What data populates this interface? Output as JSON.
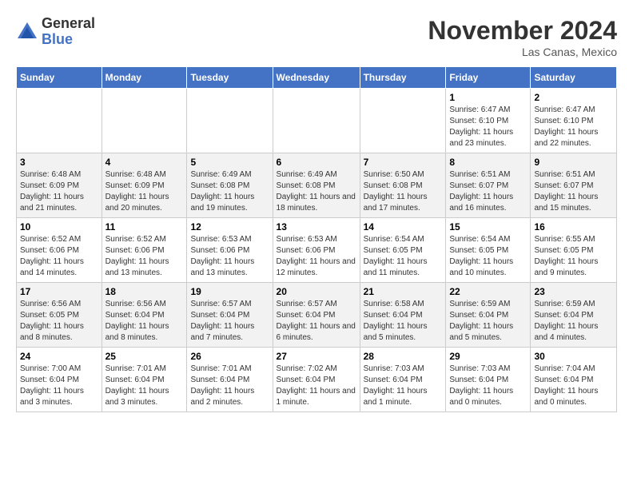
{
  "logo": {
    "general": "General",
    "blue": "Blue"
  },
  "header": {
    "month": "November 2024",
    "location": "Las Canas, Mexico"
  },
  "weekdays": [
    "Sunday",
    "Monday",
    "Tuesday",
    "Wednesday",
    "Thursday",
    "Friday",
    "Saturday"
  ],
  "weeks": [
    [
      {
        "day": "",
        "info": ""
      },
      {
        "day": "",
        "info": ""
      },
      {
        "day": "",
        "info": ""
      },
      {
        "day": "",
        "info": ""
      },
      {
        "day": "",
        "info": ""
      },
      {
        "day": "1",
        "info": "Sunrise: 6:47 AM\nSunset: 6:10 PM\nDaylight: 11 hours and 23 minutes."
      },
      {
        "day": "2",
        "info": "Sunrise: 6:47 AM\nSunset: 6:10 PM\nDaylight: 11 hours and 22 minutes."
      }
    ],
    [
      {
        "day": "3",
        "info": "Sunrise: 6:48 AM\nSunset: 6:09 PM\nDaylight: 11 hours and 21 minutes."
      },
      {
        "day": "4",
        "info": "Sunrise: 6:48 AM\nSunset: 6:09 PM\nDaylight: 11 hours and 20 minutes."
      },
      {
        "day": "5",
        "info": "Sunrise: 6:49 AM\nSunset: 6:08 PM\nDaylight: 11 hours and 19 minutes."
      },
      {
        "day": "6",
        "info": "Sunrise: 6:49 AM\nSunset: 6:08 PM\nDaylight: 11 hours and 18 minutes."
      },
      {
        "day": "7",
        "info": "Sunrise: 6:50 AM\nSunset: 6:08 PM\nDaylight: 11 hours and 17 minutes."
      },
      {
        "day": "8",
        "info": "Sunrise: 6:51 AM\nSunset: 6:07 PM\nDaylight: 11 hours and 16 minutes."
      },
      {
        "day": "9",
        "info": "Sunrise: 6:51 AM\nSunset: 6:07 PM\nDaylight: 11 hours and 15 minutes."
      }
    ],
    [
      {
        "day": "10",
        "info": "Sunrise: 6:52 AM\nSunset: 6:06 PM\nDaylight: 11 hours and 14 minutes."
      },
      {
        "day": "11",
        "info": "Sunrise: 6:52 AM\nSunset: 6:06 PM\nDaylight: 11 hours and 13 minutes."
      },
      {
        "day": "12",
        "info": "Sunrise: 6:53 AM\nSunset: 6:06 PM\nDaylight: 11 hours and 13 minutes."
      },
      {
        "day": "13",
        "info": "Sunrise: 6:53 AM\nSunset: 6:06 PM\nDaylight: 11 hours and 12 minutes."
      },
      {
        "day": "14",
        "info": "Sunrise: 6:54 AM\nSunset: 6:05 PM\nDaylight: 11 hours and 11 minutes."
      },
      {
        "day": "15",
        "info": "Sunrise: 6:54 AM\nSunset: 6:05 PM\nDaylight: 11 hours and 10 minutes."
      },
      {
        "day": "16",
        "info": "Sunrise: 6:55 AM\nSunset: 6:05 PM\nDaylight: 11 hours and 9 minutes."
      }
    ],
    [
      {
        "day": "17",
        "info": "Sunrise: 6:56 AM\nSunset: 6:05 PM\nDaylight: 11 hours and 8 minutes."
      },
      {
        "day": "18",
        "info": "Sunrise: 6:56 AM\nSunset: 6:04 PM\nDaylight: 11 hours and 8 minutes."
      },
      {
        "day": "19",
        "info": "Sunrise: 6:57 AM\nSunset: 6:04 PM\nDaylight: 11 hours and 7 minutes."
      },
      {
        "day": "20",
        "info": "Sunrise: 6:57 AM\nSunset: 6:04 PM\nDaylight: 11 hours and 6 minutes."
      },
      {
        "day": "21",
        "info": "Sunrise: 6:58 AM\nSunset: 6:04 PM\nDaylight: 11 hours and 5 minutes."
      },
      {
        "day": "22",
        "info": "Sunrise: 6:59 AM\nSunset: 6:04 PM\nDaylight: 11 hours and 5 minutes."
      },
      {
        "day": "23",
        "info": "Sunrise: 6:59 AM\nSunset: 6:04 PM\nDaylight: 11 hours and 4 minutes."
      }
    ],
    [
      {
        "day": "24",
        "info": "Sunrise: 7:00 AM\nSunset: 6:04 PM\nDaylight: 11 hours and 3 minutes."
      },
      {
        "day": "25",
        "info": "Sunrise: 7:01 AM\nSunset: 6:04 PM\nDaylight: 11 hours and 3 minutes."
      },
      {
        "day": "26",
        "info": "Sunrise: 7:01 AM\nSunset: 6:04 PM\nDaylight: 11 hours and 2 minutes."
      },
      {
        "day": "27",
        "info": "Sunrise: 7:02 AM\nSunset: 6:04 PM\nDaylight: 11 hours and 1 minute."
      },
      {
        "day": "28",
        "info": "Sunrise: 7:03 AM\nSunset: 6:04 PM\nDaylight: 11 hours and 1 minute."
      },
      {
        "day": "29",
        "info": "Sunrise: 7:03 AM\nSunset: 6:04 PM\nDaylight: 11 hours and 0 minutes."
      },
      {
        "day": "30",
        "info": "Sunrise: 7:04 AM\nSunset: 6:04 PM\nDaylight: 11 hours and 0 minutes."
      }
    ]
  ]
}
